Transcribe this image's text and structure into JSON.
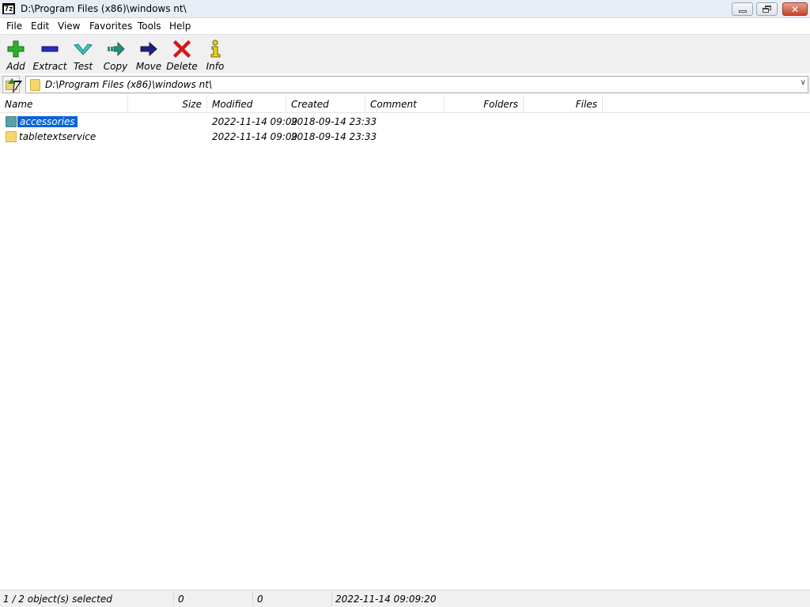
{
  "window": {
    "title": "D:\\Program Files (x86)\\windows nt\\",
    "app_icon_text": "7z"
  },
  "menu": [
    "File",
    "Edit",
    "View",
    "Favorites",
    "Tools",
    "Help"
  ],
  "toolbar": [
    {
      "label": "Add",
      "icon": "add-icon"
    },
    {
      "label": "Extract",
      "icon": "extract-icon"
    },
    {
      "label": "Test",
      "icon": "test-icon"
    },
    {
      "label": "Copy",
      "icon": "copy-icon"
    },
    {
      "label": "Move",
      "icon": "move-icon"
    },
    {
      "label": "Delete",
      "icon": "delete-icon"
    },
    {
      "label": "Info",
      "icon": "info-icon"
    }
  ],
  "address": {
    "path": "D:\\Program Files (x86)\\windows nt\\"
  },
  "columns": [
    "Name",
    "Size",
    "Modified",
    "Created",
    "Comment",
    "Folders",
    "Files"
  ],
  "rows": [
    {
      "name": "accessories",
      "size": "",
      "modified": "2022-11-14 09:09",
      "created": "2018-09-14 23:33",
      "selected": true
    },
    {
      "name": "tabletextservice",
      "size": "",
      "modified": "2022-11-14 09:09",
      "created": "2018-09-14 23:33",
      "selected": false
    }
  ],
  "status": {
    "selection": "1 / 2 object(s) selected",
    "size1": "0",
    "size2": "0",
    "datetime": "2022-11-14 09:09:20"
  },
  "colors": {
    "selection_bg": "#0a64d6",
    "toolbar_bg": "#f0f0f0"
  }
}
